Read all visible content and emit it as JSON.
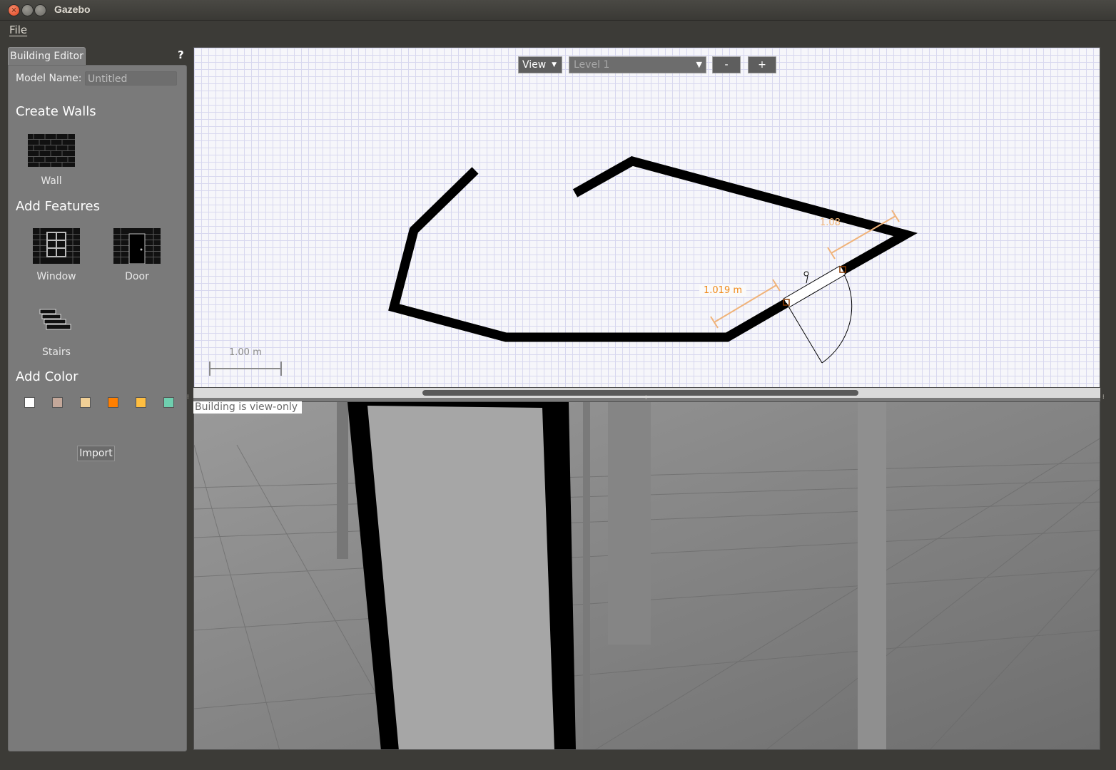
{
  "window": {
    "title": "Gazebo"
  },
  "menu": {
    "file": "File"
  },
  "tab": {
    "label": "Building Editor",
    "help": "?"
  },
  "panel": {
    "model_name_label": "Model Name:",
    "model_name_value": "Untitled",
    "create_walls": "Create Walls",
    "wall": "Wall",
    "add_features": "Add Features",
    "window": "Window",
    "door": "Door",
    "stairs": "Stairs",
    "add_color": "Add Color",
    "colors": [
      "#ffffff",
      "#c4a89a",
      "#f0cf96",
      "#ff7f00",
      "#ffbe40",
      "#6fcfaf"
    ],
    "import": "Import"
  },
  "toolbar": {
    "view": "View",
    "level": "Level 1",
    "zoom_out": "-",
    "zoom_in": "+"
  },
  "canvas": {
    "scale_label": "1.00 m",
    "measure_1": "1.019 m",
    "measure_2": "1.08"
  },
  "viewer": {
    "status": "Building is view-only"
  }
}
